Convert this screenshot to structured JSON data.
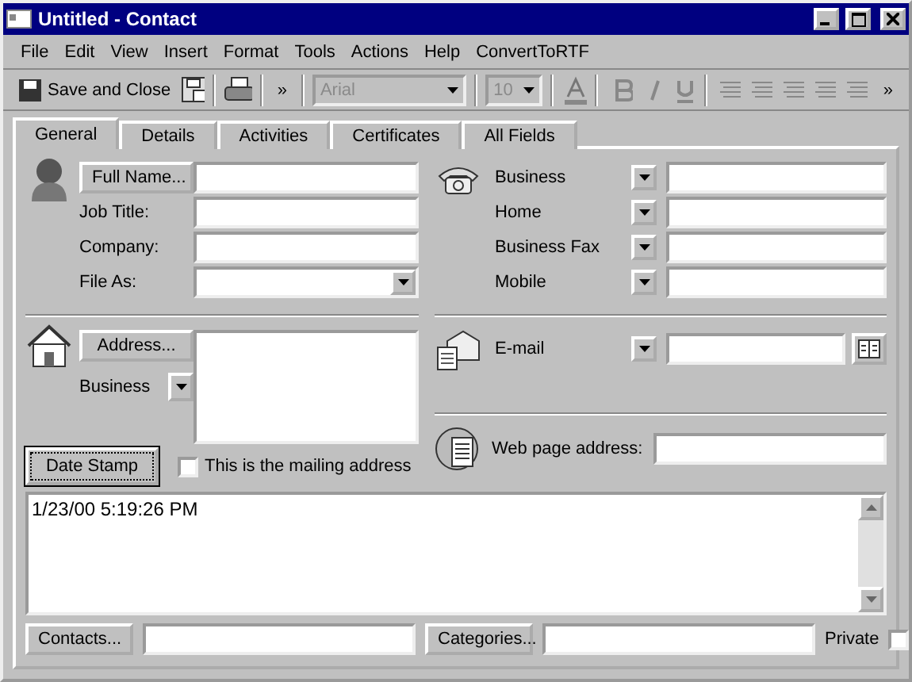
{
  "window": {
    "title": "Untitled - Contact"
  },
  "menu": [
    "File",
    "Edit",
    "View",
    "Insert",
    "Format",
    "Tools",
    "Actions",
    "Help",
    "ConvertToRTF"
  ],
  "toolbar": {
    "save_and_close": "Save and Close",
    "more": "»",
    "font": "Arial",
    "size": "10",
    "format_disabled": true,
    "end_more": "»"
  },
  "tabs": [
    {
      "label": "General",
      "selected": true
    },
    {
      "label": "Details",
      "selected": false
    },
    {
      "label": "Activities",
      "selected": false
    },
    {
      "label": "Certificates",
      "selected": false
    },
    {
      "label": "All Fields",
      "selected": false
    }
  ],
  "name": {
    "full_name_button": "Full Name...",
    "fields": [
      {
        "label": "Job Title:",
        "kind": "text"
      },
      {
        "label": "Company:",
        "kind": "text"
      },
      {
        "label": "File As:",
        "kind": "dropdown"
      }
    ]
  },
  "phones": [
    {
      "label": "Business"
    },
    {
      "label": "Home"
    },
    {
      "label": "Business Fax"
    },
    {
      "label": "Mobile"
    }
  ],
  "address": {
    "button": "Address...",
    "type": "Business",
    "mailing_label": "This is the mailing address",
    "mailing_checked": false
  },
  "email": {
    "label": "E-mail"
  },
  "web": {
    "label": "Web page address:"
  },
  "date_stamp": "Date Stamp",
  "notes": "1/23/00 5:19:26 PM",
  "footer": {
    "contacts": "Contacts...",
    "categories": "Categories...",
    "private_label": "Private",
    "private_checked": false
  }
}
